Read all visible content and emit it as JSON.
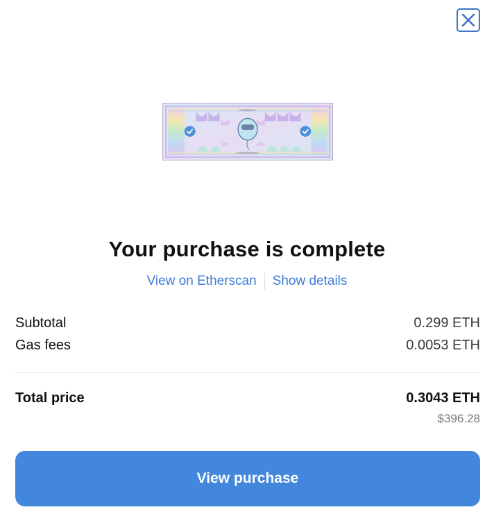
{
  "dialog": {
    "close_icon": "close-icon",
    "title": "Your purchase is complete"
  },
  "links": {
    "etherscan": "View on Etherscan",
    "details": "Show details"
  },
  "summary": {
    "subtotal_label": "Subtotal",
    "subtotal_value": "0.299 ETH",
    "gas_label": "Gas fees",
    "gas_value": "0.0053 ETH",
    "total_label": "Total price",
    "total_value": "0.3043 ETH",
    "total_usd": "$396.28"
  },
  "actions": {
    "view_purchase": "View purchase"
  },
  "colors": {
    "accent": "#4287dc",
    "link": "#3e7bd8",
    "close_border": "#3f74c9"
  }
}
